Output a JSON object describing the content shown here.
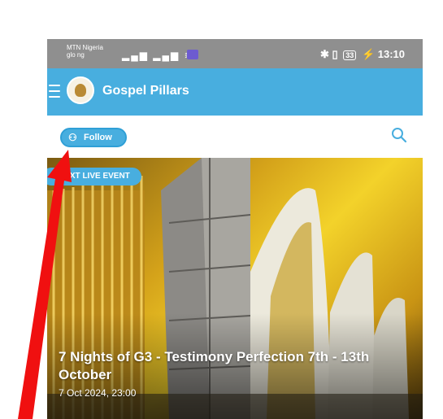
{
  "status_bar": {
    "carrier_line1": "MTN Nigeria",
    "carrier_line2": "glo ng",
    "battery": "33",
    "time": "13:10"
  },
  "app_bar": {
    "title": "Gospel Pillars"
  },
  "toolbar": {
    "follow_label": "Follow"
  },
  "hero": {
    "badge": "NEXT LIVE EVENT",
    "title": "7 Nights of G3 - Testimony Perfection 7th - 13th October",
    "date": "7 Oct 2024, 23:00"
  },
  "colors": {
    "accent": "#48aedf",
    "status_bar": "#8f8f8f",
    "annotation_arrow": "#f01010"
  }
}
